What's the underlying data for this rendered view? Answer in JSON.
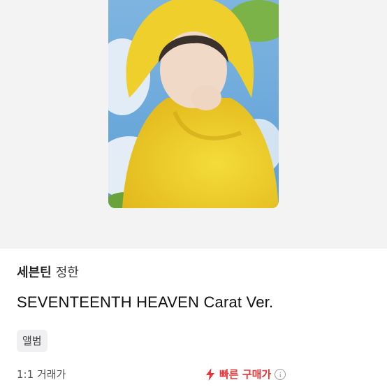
{
  "product": {
    "artist": "세븐틴",
    "member": "정한",
    "title": "SEVENTEENTH HEAVEN Carat Ver.",
    "category_tag": "앨범"
  },
  "trade": {
    "type_label": "1:1 거래가",
    "quick_buy_label": "빠른 구매가",
    "quick_buy_icon": "lightning-icon",
    "info_icon": "info-icon"
  },
  "colors": {
    "accent": "#e8373a",
    "image_bg": "#f3f3f3",
    "tag_bg": "#f0f0f2"
  }
}
